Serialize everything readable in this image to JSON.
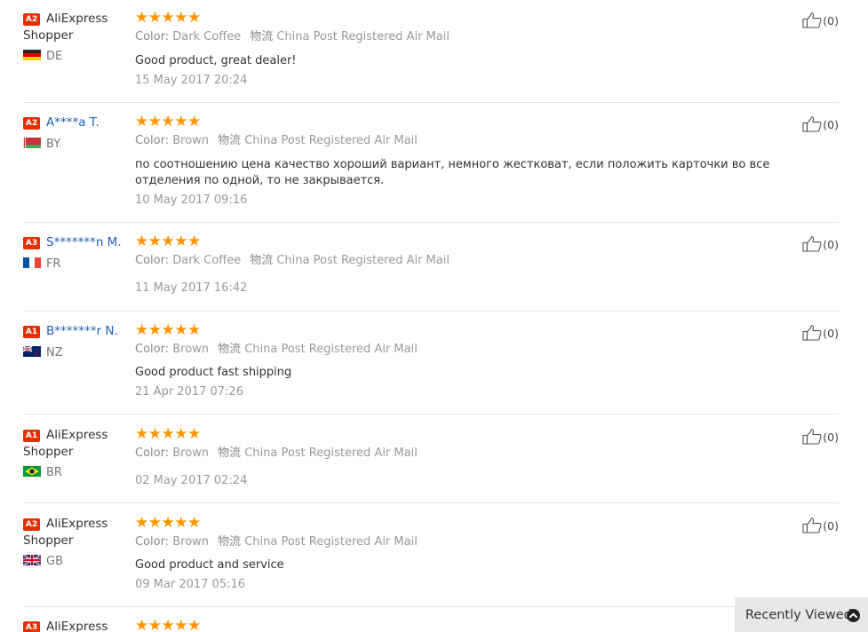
{
  "labels": {
    "color": "Color:",
    "logistics": "物流",
    "recently_viewed": "Recently Viewed"
  },
  "reviews": [
    {
      "level": "A2",
      "name": "AliExpress Shopper",
      "country": "DE",
      "rating": 5,
      "color": "Dark Coffee",
      "shipping": "China Post Registered Air Mail",
      "comment": "Good product, great dealer!",
      "date": "15 May 2017 20:24",
      "helpful": "(0)"
    },
    {
      "level": "A2",
      "name": "A****a T.",
      "country": "BY",
      "rating": 5,
      "color": "Brown",
      "shipping": "China Post Registered Air Mail",
      "comment": "по соотношению цена качество хороший вариант, немного жестковат, если положить карточки во все отделения по одной, то не закрывается.",
      "date": "10 May 2017 09:16",
      "helpful": "(0)"
    },
    {
      "level": "A3",
      "name": "S*******n M.",
      "country": "FR",
      "rating": 5,
      "color": "Dark Coffee",
      "shipping": "China Post Registered Air Mail",
      "comment": "",
      "date": "11 May 2017 16:42",
      "helpful": "(0)"
    },
    {
      "level": "A1",
      "name": "B*******r N.",
      "country": "NZ",
      "rating": 5,
      "color": "Brown",
      "shipping": "China Post Registered Air Mail",
      "comment": "Good product fast shipping",
      "date": "21 Apr 2017 07:26",
      "helpful": "(0)"
    },
    {
      "level": "A1",
      "name": "AliExpress Shopper",
      "country": "BR",
      "rating": 5,
      "color": "Brown",
      "shipping": "China Post Registered Air Mail",
      "comment": "",
      "date": "02 May 2017 02:24",
      "helpful": "(0)"
    },
    {
      "level": "A2",
      "name": "AliExpress Shopper",
      "country": "GB",
      "rating": 5,
      "color": "Brown",
      "shipping": "China Post Registered Air Mail",
      "comment": "Good product and service",
      "date": "09 Mar 2017 05:16",
      "helpful": "(0)"
    },
    {
      "level": "A3",
      "name": "AliExpress",
      "country": "",
      "rating": 5,
      "color": "",
      "shipping": "",
      "comment": "",
      "date": "",
      "helpful": ""
    }
  ],
  "colors": {
    "badge": "#e62e04",
    "stars": "#ff9600",
    "link_name": "#1d5fb4"
  }
}
